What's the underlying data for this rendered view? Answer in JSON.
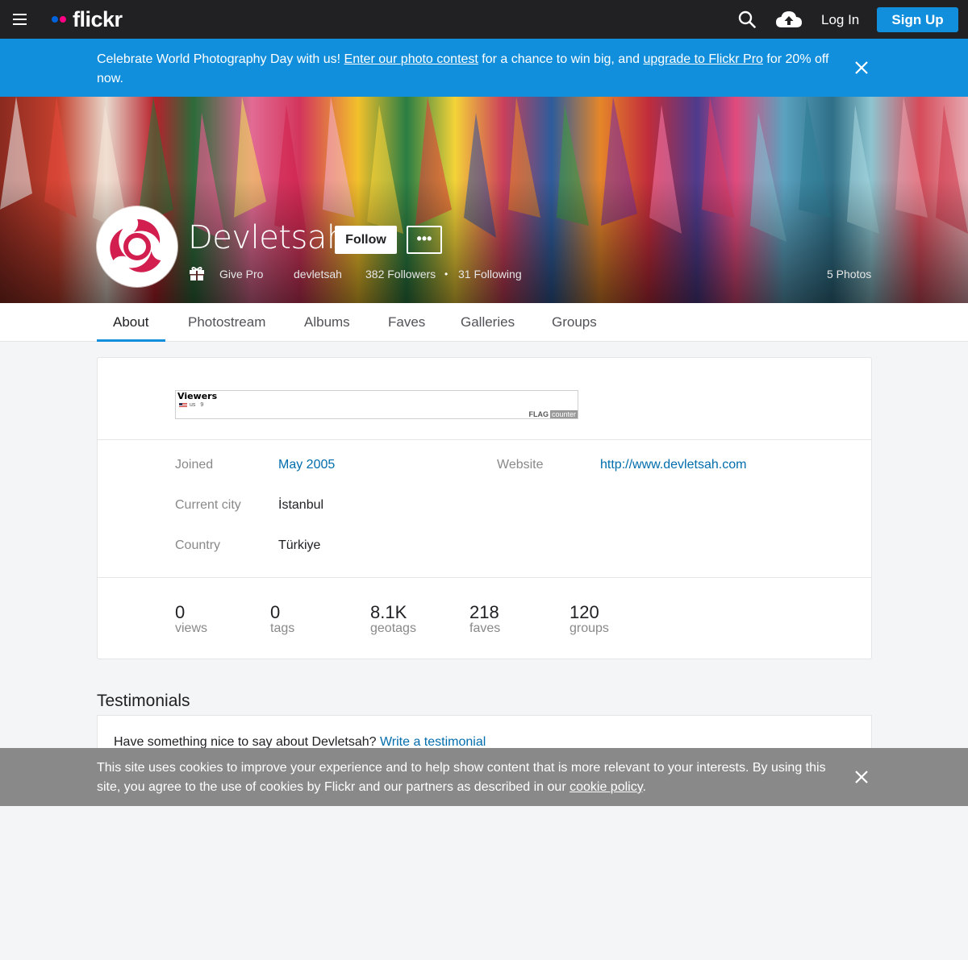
{
  "nav": {
    "logo_text": "flickr",
    "login_label": "Log In",
    "signup_label": "Sign Up",
    "icons": [
      "menu-icon",
      "search-icon",
      "upload-icon"
    ],
    "colors": {
      "bar": "#212124",
      "brand_blue": "#0063dc",
      "brand_pink": "#ff0084",
      "signup": "#128fdc"
    }
  },
  "promo": {
    "text_1": "Celebrate World Photography Day with us! ",
    "link_1": "Enter our photo contest",
    "text_2": " for a chance to win big, and ",
    "link_2": "upgrade to Flickr Pro",
    "text_3": " for 20% off now.",
    "background": "#128fdc"
  },
  "profile": {
    "name": "Devletsah",
    "follow_label": "Follow",
    "more_label": "•••",
    "give_pro": "Give Pro",
    "username": "devletsah",
    "followers": "382 Followers",
    "separator": "•",
    "following": "31 Following",
    "photos": "5 Photos"
  },
  "tabs": [
    {
      "label": "About",
      "active": true
    },
    {
      "label": "Photostream"
    },
    {
      "label": "Albums"
    },
    {
      "label": "Faves"
    },
    {
      "label": "Galleries"
    },
    {
      "label": "Groups"
    }
  ],
  "flag_counter": {
    "title": "Viewers",
    "country": "us",
    "count": "9",
    "brand": "FLAG",
    "brand_suffix": "counter"
  },
  "about": {
    "joined_label": "Joined",
    "joined_value": "May 2005",
    "website_label": "Website",
    "website_value": "http://www.devletsah.com",
    "city_label": "Current city",
    "city_value": "İstanbul",
    "country_label": "Country",
    "country_value": "Türkiye"
  },
  "stats": [
    {
      "value": "0",
      "label": "views"
    },
    {
      "value": "0",
      "label": "tags"
    },
    {
      "value": "8.1K",
      "label": "geotags"
    },
    {
      "value": "218",
      "label": "faves"
    },
    {
      "value": "120",
      "label": "groups"
    }
  ],
  "testimonials": {
    "title": "Testimonials",
    "prompt": "Have something nice to say about Devletsah? ",
    "link": "Write a testimonial"
  },
  "cookie": {
    "text": "This site uses cookies to improve your experience and to help show content that is more relevant to your interests. By using this site, you agree to the use of cookies by Flickr and our partners as described in our ",
    "link": "cookie policy",
    "end": "."
  }
}
